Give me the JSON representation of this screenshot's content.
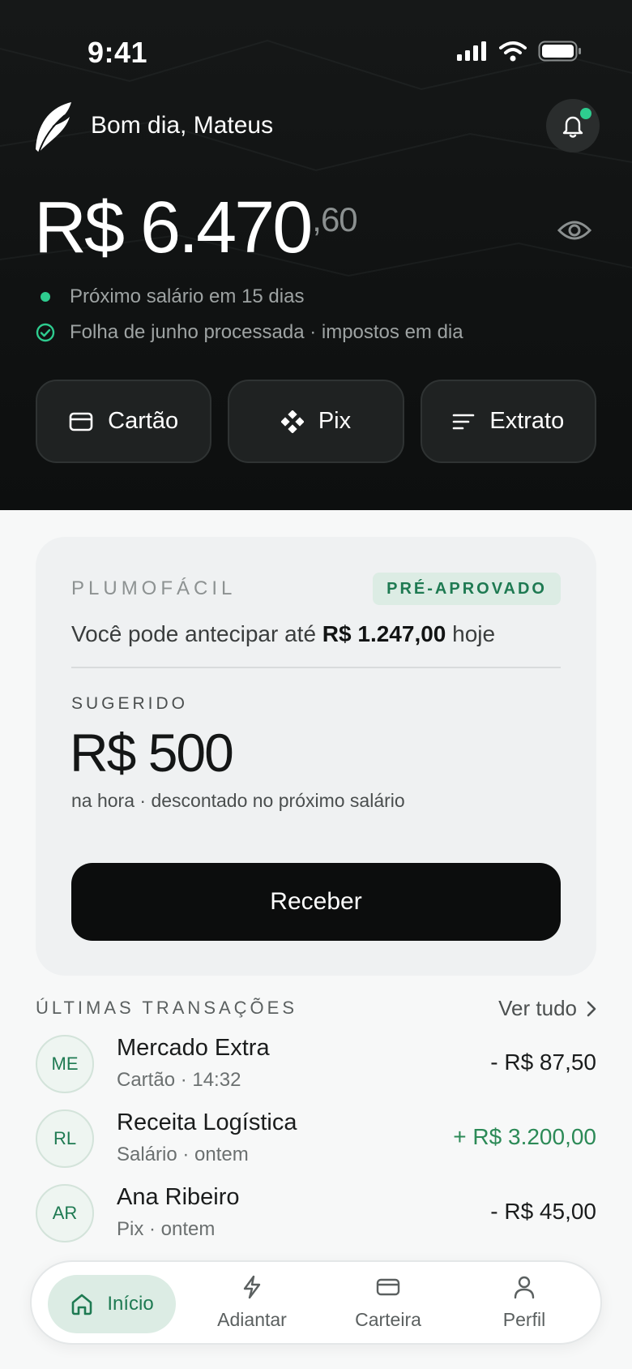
{
  "status_bar": {
    "time": "9:41"
  },
  "header": {
    "greeting": "Bom dia, Mateus",
    "balance_main": "R$ 6.470",
    "balance_cents": ",60",
    "info_1": "Próximo salário em 15 dias",
    "info_2": "Folha de junho processada · impostos em dia"
  },
  "actions": [
    {
      "label": "Cartão",
      "icon": "card-icon"
    },
    {
      "label": "Pix",
      "icon": "pix-icon"
    },
    {
      "label": "Extrato",
      "icon": "list-icon"
    }
  ],
  "offer": {
    "brand": "PLUMOFÁCIL",
    "badge": "PRÉ-APROVADO",
    "text_prefix": "Você pode antecipar até",
    "limit": "R$ 1.247,00",
    "text_suffix": "hoje",
    "suggested_label": "SUGERIDO",
    "suggested_value": "R$ 500",
    "note": "na hora · descontado no próximo salário",
    "cta": "Receber"
  },
  "transactions": {
    "title": "ÚLTIMAS TRANSAÇÕES",
    "see_all": "Ver tudo",
    "items": [
      {
        "initials": "ME",
        "name": "Mercado Extra",
        "sub": "Cartão · 14:32",
        "amount": "- R$ 87,50",
        "positive": false
      },
      {
        "initials": "RL",
        "name": "Receita Logística",
        "sub": "Salário · ontem",
        "amount": "+ R$ 3.200,00",
        "positive": true
      },
      {
        "initials": "AR",
        "name": "Ana Ribeiro",
        "sub": "Pix · ontem",
        "amount": "- R$ 45,00",
        "positive": false
      }
    ]
  },
  "nav": {
    "home": "Início",
    "advance": "Adiantar",
    "wallet": "Carteira",
    "profile": "Perfil"
  },
  "colors": {
    "accent_green": "#2ecc8f",
    "positive_amount": "#2c8a57",
    "badge_bg": "#dcece4",
    "hero_bg": "#101212"
  }
}
